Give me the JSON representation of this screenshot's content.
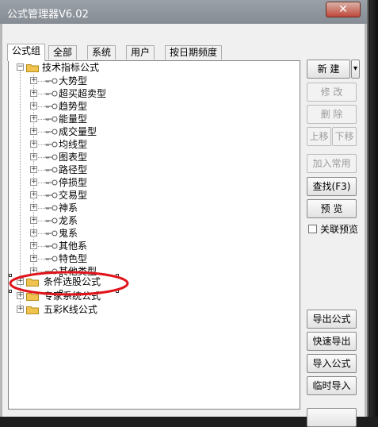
{
  "window": {
    "title": "公式管理器V6.02",
    "close_glyph": "✕"
  },
  "tabs": [
    "公式组",
    "全部",
    "系统",
    "用户",
    "按日期频度"
  ],
  "tree": {
    "root1": "技术指标公式",
    "children": [
      "大势型",
      "超买超卖型",
      "趋势型",
      "能量型",
      "成交量型",
      "均线型",
      "图表型",
      "路径型",
      "停损型",
      "交易型",
      "神系",
      "龙系",
      "鬼系",
      "其他系",
      "特色型",
      "其他类型"
    ],
    "root2": "条件选股公式",
    "root3": "专家系统公式",
    "root4": "五彩K线公式"
  },
  "buttons": {
    "new_label": "新 建",
    "new_dropdown": "▾",
    "modify": "修 改",
    "delete": "删 除",
    "move_up": "上移",
    "move_down": "下移",
    "add_common": "加入常用",
    "find": "查找(F3)",
    "preview": "预 览",
    "link_preview": "关联预览",
    "export": "导出公式",
    "quick_export": "快速导出",
    "import": "导入公式",
    "temp_import": "临时导入"
  },
  "colors": {
    "folder": "#f0c34e",
    "highlight_ellipse": "#e0141b"
  }
}
